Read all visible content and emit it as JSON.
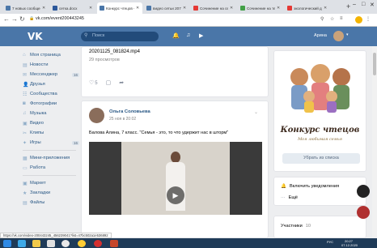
{
  "browser": {
    "tabs": [
      {
        "label": "7 новых сообщен",
        "color": "#4a76a8"
      },
      {
        "label": "сетка.docx",
        "color": "#2b579a"
      },
      {
        "label": "Конкурс чтецов - В",
        "color": "#4a76a8",
        "active": true
      },
      {
        "label": "видео сетьи 207",
        "color": "#4a76a8"
      },
      {
        "label": "Сочинение на сетьи",
        "color": "#e53935"
      },
      {
        "label": "Сочинение на тему",
        "color": "#43a047"
      },
      {
        "label": "экологический д",
        "color": "#e53935"
      }
    ],
    "url": "vk.com/event200443245",
    "new_tab": "+"
  },
  "vk_header": {
    "logo": "VK",
    "search_placeholder": "Поиск",
    "user_name": "Арина"
  },
  "sidebar": {
    "items": [
      {
        "label": "Моя страница",
        "icon": "home-icon",
        "glyph": "⌂",
        "count": ""
      },
      {
        "label": "Новости",
        "icon": "news-icon",
        "glyph": "▤",
        "count": ""
      },
      {
        "label": "Мессенджер",
        "icon": "messenger-icon",
        "glyph": "✉",
        "count": "16"
      },
      {
        "label": "Друзья",
        "icon": "friends-icon",
        "glyph": "👤",
        "count": ""
      },
      {
        "label": "Сообщества",
        "icon": "communities-icon",
        "glyph": "☷",
        "count": ""
      },
      {
        "label": "Фотографии",
        "icon": "photos-icon",
        "glyph": "◙",
        "count": ""
      },
      {
        "label": "Музыка",
        "icon": "music-icon",
        "glyph": "♫",
        "count": ""
      },
      {
        "label": "Видео",
        "icon": "video-icon",
        "glyph": "▣",
        "count": ""
      },
      {
        "label": "Клипы",
        "icon": "clips-icon",
        "glyph": "✂",
        "count": ""
      },
      {
        "label": "Игры",
        "icon": "games-icon",
        "glyph": "✦",
        "count": "16"
      }
    ],
    "items2": [
      {
        "label": "Мини-приложения",
        "icon": "apps-icon",
        "glyph": "▦"
      },
      {
        "label": "Работа",
        "icon": "work-icon",
        "glyph": "▭"
      }
    ],
    "items3": [
      {
        "label": "Маркет",
        "icon": "market-icon",
        "glyph": "▣"
      },
      {
        "label": "Закладки",
        "icon": "bookmarks-icon",
        "glyph": "★"
      },
      {
        "label": "Файлы",
        "icon": "files-icon",
        "glyph": "▤"
      }
    ]
  },
  "feed": {
    "prev_post": {
      "video_name": "20201125_081824.mp4",
      "views": "29 просмотров",
      "likes": "5"
    },
    "post": {
      "author": "Ольга Соловьева",
      "date": "25 ноя в 20:02",
      "text": "Балова Алина, 7 класс. \"Семья - это, то что удержит нас в шторм\""
    }
  },
  "right": {
    "contest_title": "Конкурс чтецов",
    "contest_subtitle": "Моя любимая семья",
    "remove_button": "Убрать из списка",
    "notifications": "Включить уведомления",
    "more": "Ещё",
    "members_label": "Участники",
    "members_count": "10"
  },
  "status_link": "https://vk.com/video-200443245_456239041?list=47bc502a1e536892",
  "taskbar": {
    "time": "20:27",
    "date": "07.12.2020",
    "lang": "РУС"
  }
}
